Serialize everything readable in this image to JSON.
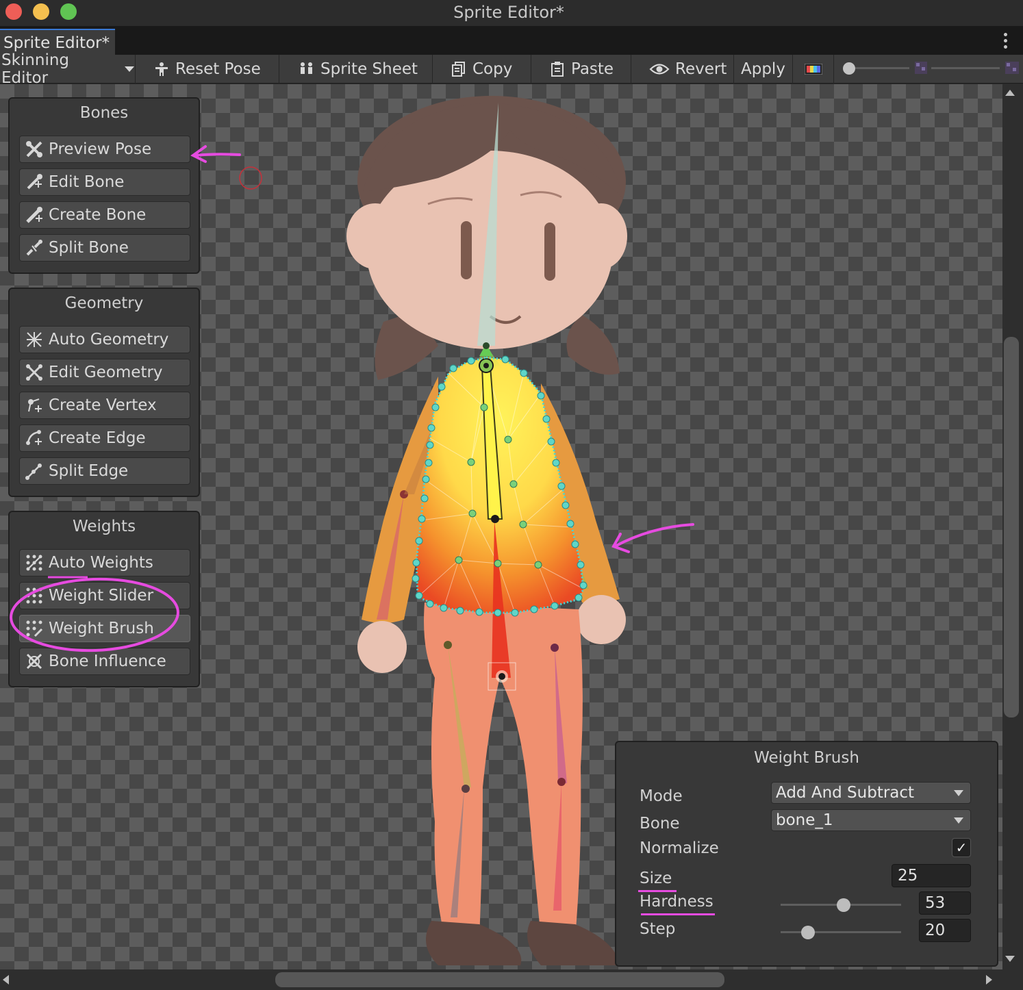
{
  "window": {
    "title": "Sprite Editor*"
  },
  "tab": {
    "label": "Sprite Editor*"
  },
  "toolbar": {
    "mode_label": "Skinning Editor",
    "reset_pose": "Reset Pose",
    "sprite_sheet": "Sprite Sheet",
    "copy": "Copy",
    "paste": "Paste",
    "revert": "Revert",
    "apply": "Apply"
  },
  "panels": {
    "bones": {
      "title": "Bones",
      "buttons": [
        "Preview Pose",
        "Edit Bone",
        "Create Bone",
        "Split Bone"
      ]
    },
    "geometry": {
      "title": "Geometry",
      "buttons": [
        "Auto Geometry",
        "Edit Geometry",
        "Create Vertex",
        "Create Edge",
        "Split Edge"
      ]
    },
    "weights": {
      "title": "Weights",
      "buttons": [
        "Auto Weights",
        "Weight Slider",
        "Weight Brush",
        "Bone Influence"
      ]
    }
  },
  "weight_brush": {
    "title": "Weight Brush",
    "mode_label": "Mode",
    "mode_value": "Add And Subtract",
    "bone_label": "Bone",
    "bone_value": "bone_1",
    "normalize_label": "Normalize",
    "normalize_checked": true,
    "size_label": "Size",
    "size_value": "25",
    "hardness_label": "Hardness",
    "hardness_value": "53",
    "step_label": "Step",
    "step_value": "20"
  },
  "colors": {
    "annotation": "#e64be0",
    "mesh_outline": "#46d6d6",
    "accent": "#3a79d4"
  }
}
